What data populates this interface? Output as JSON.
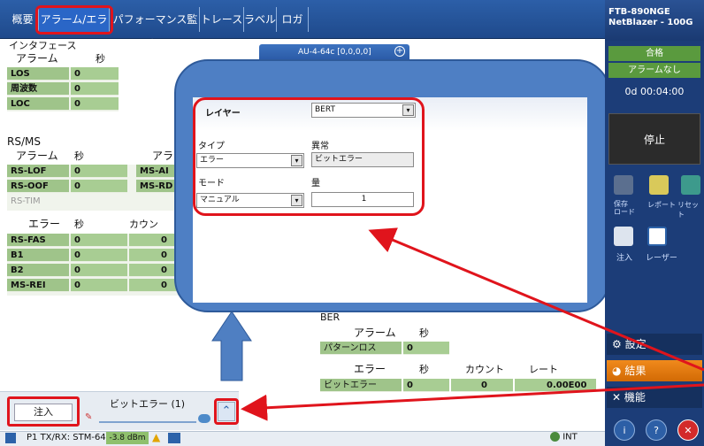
{
  "tabs": [
    "概要",
    "アラーム/エラー",
    "パフォーマンス監視",
    "トレース",
    "ラベル",
    "ロガー"
  ],
  "interface": {
    "title": "インタフェース",
    "alarm_hdr": "アラーム",
    "sec_hdr": "秒",
    "rows": [
      {
        "name": "LOS",
        "v": "0"
      },
      {
        "name": "周波数",
        "v": "0"
      },
      {
        "name": "LOC",
        "v": "0"
      }
    ]
  },
  "rsms": {
    "title": "RS/MS",
    "alarm_hdr": "アラーム",
    "sec_hdr": "秒",
    "alarm_hdr2": "アラ",
    "rows": [
      {
        "name": "RS-LOF",
        "v": "0",
        "name2": "MS-AI"
      },
      {
        "name": "RS-OOF",
        "v": "0",
        "name2": "MS-RD"
      },
      {
        "name": "RS-TIM",
        "v": ""
      }
    ],
    "err_hdr": "エラー",
    "sec_hdr2": "秒",
    "count_hdr": "カウン",
    "err_rows": [
      {
        "name": "RS-FAS",
        "v": "0",
        "c": "0"
      },
      {
        "name": "B1",
        "v": "0",
        "c": "0"
      },
      {
        "name": "B2",
        "v": "0",
        "c": "0"
      },
      {
        "name": "MS-REI",
        "v": "0",
        "c": "0"
      }
    ]
  },
  "au_tab": "AU-4-64c [0,0,0,0]",
  "modal": {
    "layer_label": "レイヤー",
    "layer_value": "BERT",
    "type_label": "タイプ",
    "anomaly_label": "異常",
    "type_value": "エラー",
    "anomaly_value": "ビットエラー",
    "mode_label": "モード",
    "amount_label": "量",
    "mode_value": "マニュアル",
    "amount_value": "1"
  },
  "ber": {
    "title": "BER",
    "alarm_hdr": "アラーム",
    "sec_hdr": "秒",
    "alarm_rows": [
      {
        "name": "パターンロス",
        "v": "0"
      }
    ],
    "err_hdr": "エラー",
    "sec_hdr2": "秒",
    "count_hdr": "カウント",
    "rate_hdr": "レート",
    "err_rows": [
      {
        "name": "ビットエラー",
        "v": "0",
        "c": "0",
        "r": "0.00E00"
      }
    ]
  },
  "inject": {
    "button": "注入",
    "label": "ビットエラー (1)"
  },
  "status": {
    "port": "P1 TX/RX: STM-64",
    "power": "-3.8 dBm",
    "clock": "INT"
  },
  "device": {
    "model": "FTB-890NGE",
    "name": "NetBlazer - 100G",
    "pass": "合格",
    "no_alarm": "アラームなし",
    "timer": "0d 00:04:00",
    "stop": "停止",
    "save": "保存",
    "load": "ロード",
    "report": "レポート",
    "reset": "リセット",
    "inject": "注入",
    "laser": "レーザー",
    "settings": "設定",
    "results": "結果",
    "functions": "機能"
  }
}
